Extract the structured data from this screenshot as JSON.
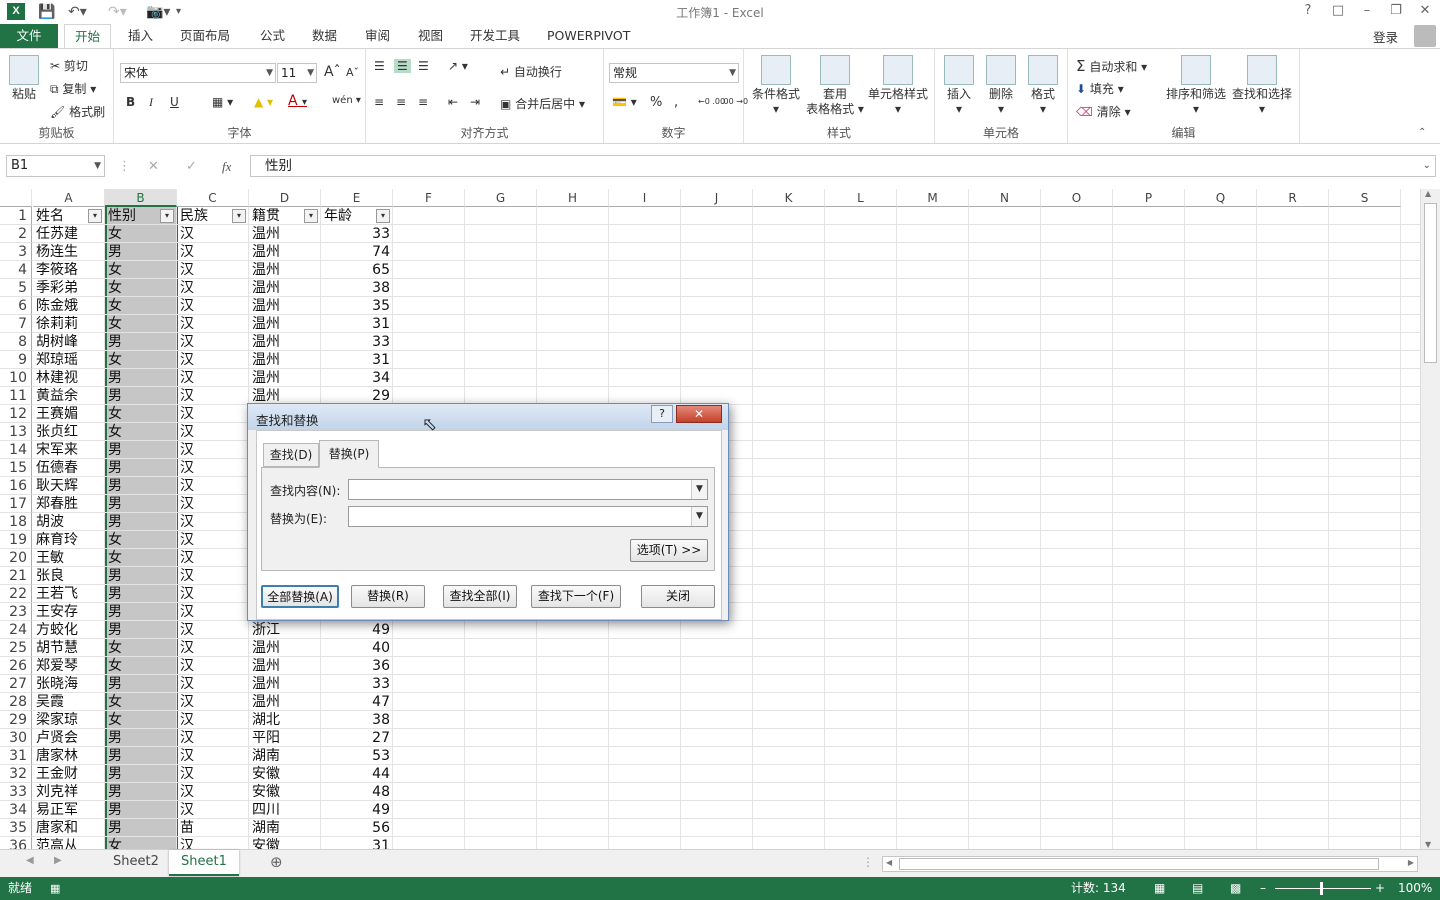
{
  "app": {
    "title": "工作簿1 - Excel",
    "login": "登录"
  },
  "tabs": [
    "文件",
    "开始",
    "插入",
    "页面布局",
    "公式",
    "数据",
    "审阅",
    "视图",
    "开发工具",
    "POWERPIVOT"
  ],
  "ribbon": {
    "clipboard": {
      "paste": "粘贴",
      "cut": "剪切",
      "copy": "复制",
      "format_painter": "格式刷",
      "label": "剪贴板"
    },
    "font": {
      "name": "宋体",
      "size": "11",
      "label": "字体",
      "bold": "B",
      "italic": "I",
      "underline": "U",
      "grow": "A",
      "shrink": "A",
      "color_a": "A",
      "phonetic": "wén"
    },
    "alignment": {
      "wrap": "自动换行",
      "merge": "合并后居中",
      "label": "对齐方式"
    },
    "number": {
      "format": "常规",
      "percent": "%",
      "comma": ",",
      "inc_dec": "←0 .00",
      "dec_dec": ".00 →0",
      "label": "数字"
    },
    "styles": {
      "conditional": "条件格式",
      "table_a": "套用",
      "table_b": "表格格式",
      "cell_styles": "单元格样式",
      "label": "样式"
    },
    "cells": {
      "insert": "插入",
      "delete": "删除",
      "format": "格式",
      "label": "单元格"
    },
    "editing": {
      "autosum": "自动求和",
      "fill": "填充",
      "clear": "清除",
      "sort": "排序和筛选",
      "find": "查找和选择",
      "label": "编辑"
    }
  },
  "formula_bar": {
    "name_box": "B1",
    "fx": "fx",
    "value": "性别"
  },
  "columns": [
    "A",
    "B",
    "C",
    "D",
    "E",
    "F",
    "G",
    "H",
    "I",
    "J",
    "K",
    "L",
    "M",
    "N",
    "O",
    "P",
    "Q",
    "R",
    "S"
  ],
  "header_row": [
    "姓名",
    "性别",
    "民族",
    "籍贯",
    "年龄"
  ],
  "rows": [
    [
      "任苏建",
      "女",
      "汉",
      "温州",
      "33"
    ],
    [
      "杨连生",
      "男",
      "汉",
      "温州",
      "74"
    ],
    [
      "李筱珞",
      "女",
      "汉",
      "温州",
      "65"
    ],
    [
      "季彩弟",
      "女",
      "汉",
      "温州",
      "38"
    ],
    [
      "陈金娥",
      "女",
      "汉",
      "温州",
      "35"
    ],
    [
      "徐莉莉",
      "女",
      "汉",
      "温州",
      "31"
    ],
    [
      "胡树峰",
      "男",
      "汉",
      "温州",
      "33"
    ],
    [
      "郑琼瑶",
      "女",
      "汉",
      "温州",
      "31"
    ],
    [
      "林建视",
      "男",
      "汉",
      "温州",
      "34"
    ],
    [
      "黄益余",
      "男",
      "汉",
      "温州",
      "29"
    ],
    [
      "王赛媚",
      "女",
      "汉",
      "",
      ""
    ],
    [
      "张贞红",
      "女",
      "汉",
      "",
      ""
    ],
    [
      "宋军来",
      "男",
      "汉",
      "",
      ""
    ],
    [
      "伍德春",
      "男",
      "汉",
      "",
      ""
    ],
    [
      "耿天辉",
      "男",
      "汉",
      "",
      ""
    ],
    [
      "郑春胜",
      "男",
      "汉",
      "",
      ""
    ],
    [
      "胡波",
      "男",
      "汉",
      "",
      ""
    ],
    [
      "麻育玲",
      "女",
      "汉",
      "",
      ""
    ],
    [
      "王敏",
      "女",
      "汉",
      "",
      ""
    ],
    [
      "张良",
      "男",
      "汉",
      "",
      ""
    ],
    [
      "王若飞",
      "男",
      "汉",
      "",
      ""
    ],
    [
      "王安存",
      "男",
      "汉",
      "",
      ""
    ],
    [
      "方蛟化",
      "男",
      "汉",
      "浙江",
      "49"
    ],
    [
      "胡节慧",
      "女",
      "汉",
      "温州",
      "40"
    ],
    [
      "郑爱琴",
      "女",
      "汉",
      "温州",
      "36"
    ],
    [
      "张晓海",
      "男",
      "汉",
      "温州",
      "33"
    ],
    [
      "吴霞",
      "女",
      "汉",
      "温州",
      "47"
    ],
    [
      "梁家琼",
      "女",
      "汉",
      "湖北",
      "38"
    ],
    [
      "卢贤会",
      "男",
      "汉",
      "平阳",
      "27"
    ],
    [
      "唐家林",
      "男",
      "汉",
      "湖南",
      "53"
    ],
    [
      "王金财",
      "男",
      "汉",
      "安徽",
      "44"
    ],
    [
      "刘克祥",
      "男",
      "汉",
      "安徽",
      "48"
    ],
    [
      "易正军",
      "男",
      "汉",
      "四川",
      "49"
    ],
    [
      "唐家和",
      "男",
      "苗",
      "湖南",
      "56"
    ],
    [
      "范高从",
      "女",
      "汉",
      "安徽",
      "31"
    ]
  ],
  "sheets": [
    "Sheet2",
    "Sheet1"
  ],
  "status": {
    "ready": "就绪",
    "count": "计数: 134",
    "zoom": "100%"
  },
  "dialog": {
    "title": "查找和替换",
    "help": "?",
    "tab_find": "查找(D)",
    "tab_replace": "替换(P)",
    "find_label": "查找内容(N):",
    "find_value": "",
    "replace_label": "替换为(E):",
    "replace_value": "",
    "options": "选项(T) >>",
    "replace_all": "全部替换(A)",
    "replace": "替换(R)",
    "find_all": "查找全部(I)",
    "find_next": "查找下一个(F)",
    "close": "关闭"
  },
  "colors": {
    "accent": "#217346",
    "selection": "#c6c6c6"
  }
}
